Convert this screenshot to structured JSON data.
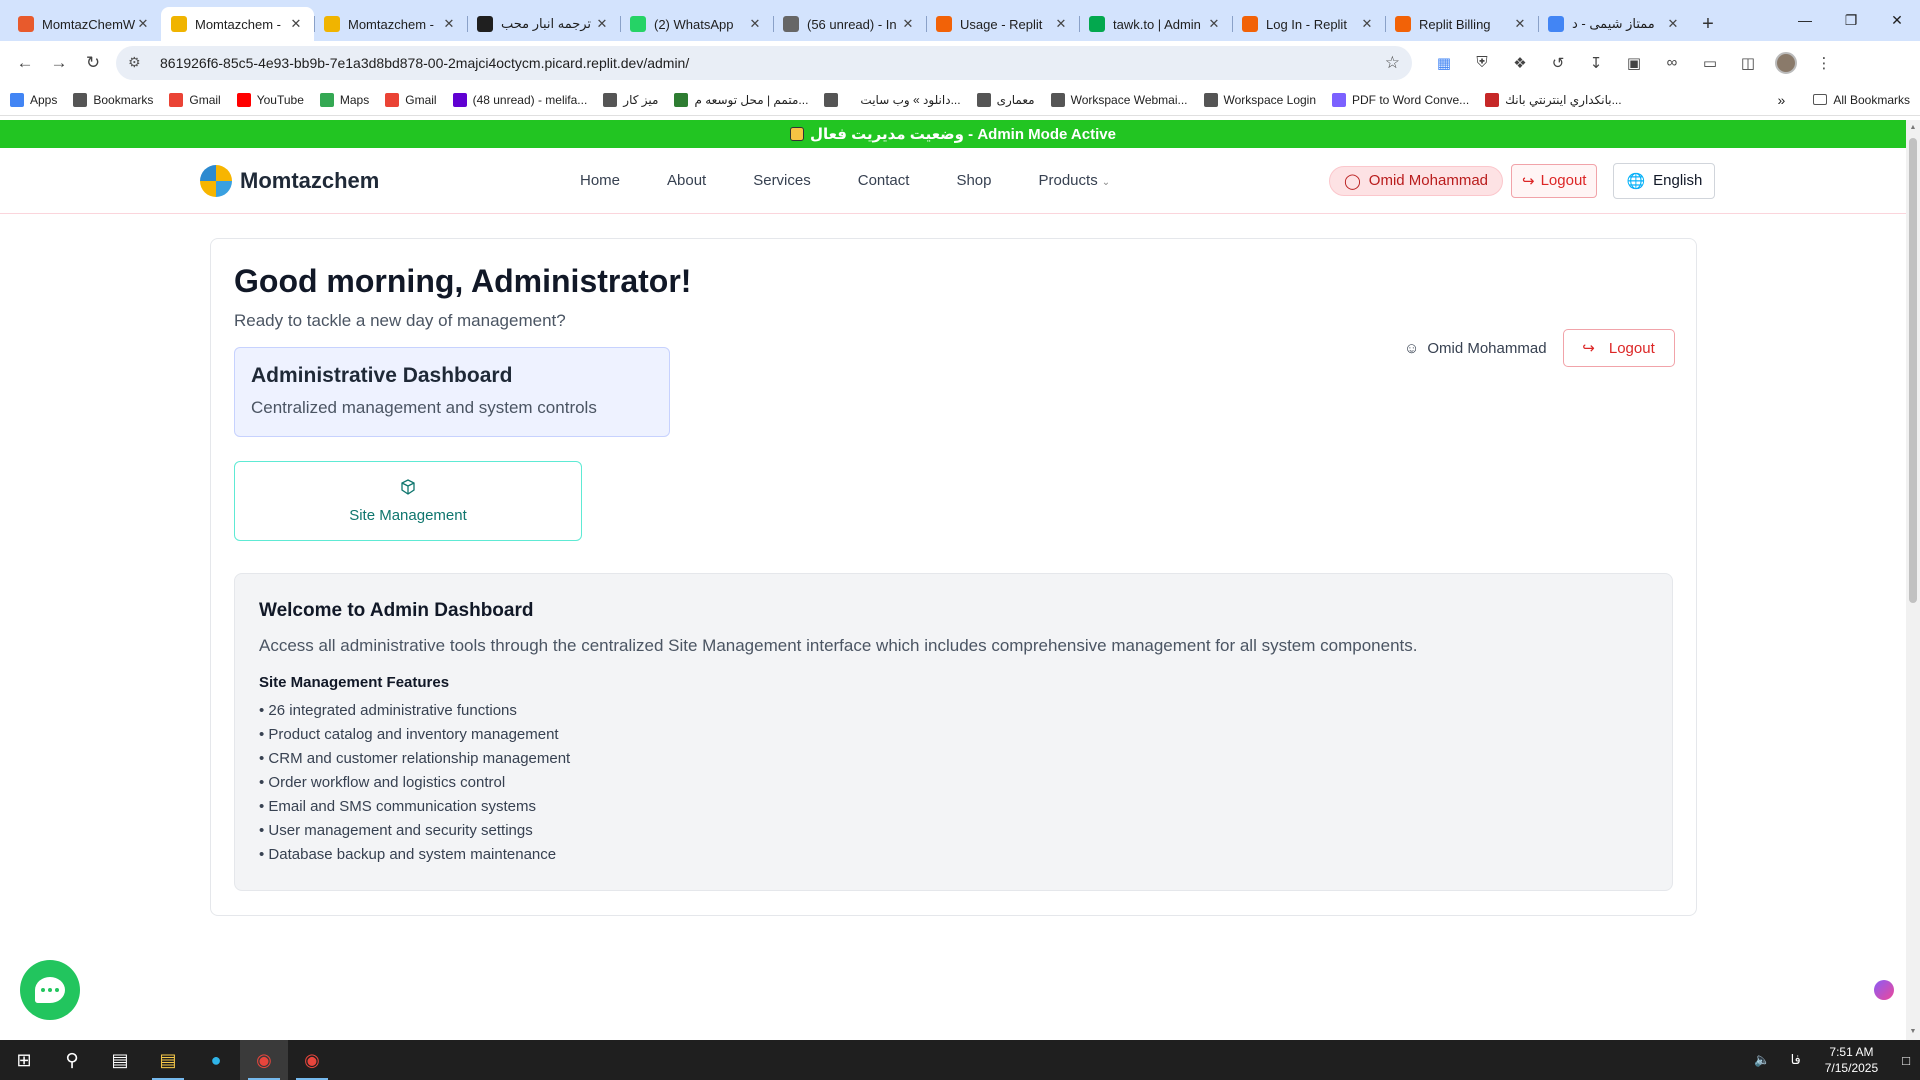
{
  "browser": {
    "tabs": [
      {
        "title": "MomtazChemW",
        "favicon_color": "#e85a2c",
        "active": false
      },
      {
        "title": "Momtazchem -",
        "favicon_color": "#f0b400",
        "active": true
      },
      {
        "title": "Momtazchem -",
        "favicon_color": "#f0b400",
        "active": false
      },
      {
        "title": "ترجمه انبار محب",
        "favicon_color": "#1f1f1f",
        "active": false
      },
      {
        "title": "(2) WhatsApp",
        "favicon_color": "#25d366",
        "active": false
      },
      {
        "title": "(56 unread) - In",
        "favicon_color": "#666666",
        "active": false
      },
      {
        "title": "Usage - Replit",
        "favicon_color": "#f26207",
        "active": false
      },
      {
        "title": "tawk.to | Admin",
        "favicon_color": "#03a84e",
        "active": false
      },
      {
        "title": "Log In - Replit",
        "favicon_color": "#f26207",
        "active": false
      },
      {
        "title": "Replit Billing",
        "favicon_color": "#f26207",
        "active": false
      },
      {
        "title": "ممتاز شیمی - د",
        "favicon_color": "#4285f4",
        "active": false
      }
    ],
    "new_tab_label": "+",
    "url": "861926f6-85c5-4e93-bb9b-7e1a3d8bd878-00-2majci4octycm.picard.replit.dev/admin/",
    "bookmarks": [
      {
        "label": "Apps",
        "icon": "apps-grid-icon",
        "color": "#4285f4"
      },
      {
        "label": "Bookmarks",
        "icon": "star-icon",
        "color": "#555555"
      },
      {
        "label": "Gmail",
        "icon": "gmail-icon",
        "color": "#ea4335"
      },
      {
        "label": "YouTube",
        "icon": "youtube-icon",
        "color": "#ff0000"
      },
      {
        "label": "Maps",
        "icon": "maps-icon",
        "color": "#34a853"
      },
      {
        "label": "Gmail",
        "icon": "gmail-icon",
        "color": "#ea4335"
      },
      {
        "label": "(48 unread) - melifa...",
        "icon": "yahoo-mail-icon",
        "color": "#6001d2"
      },
      {
        "label": "میز کار",
        "icon": "globe-icon",
        "color": "#555555"
      },
      {
        "label": "متمم | محل توسعه م...",
        "icon": "leaf-icon",
        "color": "#2e7d32"
      },
      {
        "label": "",
        "icon": "globe-icon",
        "color": "#555555"
      },
      {
        "label": "دانلود » وب سایت...",
        "icon": "",
        "color": "#555555"
      },
      {
        "label": "معماری",
        "icon": "folder-icon",
        "color": "#555555"
      },
      {
        "label": "Workspace Webmai...",
        "icon": "globe-icon",
        "color": "#555555"
      },
      {
        "label": "Workspace Login",
        "icon": "globe-icon",
        "color": "#555555"
      },
      {
        "label": "PDF to Word Conve...",
        "icon": "pdf-icon",
        "color": "#7b61ff"
      },
      {
        "label": "بانكداري اينترنتي بانك...",
        "icon": "bank-icon",
        "color": "#c62828"
      }
    ],
    "all_bookmarks_label": "All Bookmarks"
  },
  "site": {
    "admin_banner": "وضعیت مدیریت فعال - Admin Mode Active",
    "brand_name": "Momtazchem",
    "nav": [
      "Home",
      "About",
      "Services",
      "Contact",
      "Shop",
      "Products"
    ],
    "user_pill": "Omid Mohammad",
    "logout_label": "Logout",
    "language_label": "English"
  },
  "dashboard": {
    "greeting": "Good morning, Administrator!",
    "subtitle": "Ready to tackle a new day of management?",
    "panel_title": "Administrative Dashboard",
    "panel_subtitle": "Centralized management and system controls",
    "user_name": "Omid Mohammad",
    "logout_label": "Logout",
    "site_management_label": "Site Management",
    "welcome_title": "Welcome to Admin Dashboard",
    "welcome_desc": "Access all administrative tools through the centralized Site Management interface which includes comprehensive management for all system components.",
    "features_title": "Site Management Features",
    "features": [
      "• 26 integrated administrative functions",
      "• Product catalog and inventory management",
      "• CRM and customer relationship management",
      "• Order workflow and logistics control",
      "• Email and SMS communication systems",
      "• User management and security settings",
      "• Database backup and system maintenance"
    ]
  },
  "taskbar": {
    "language_indicator": "فا",
    "time": "7:51 AM",
    "date": "7/15/2025"
  },
  "colors": {
    "banner_green": "#22c522",
    "accent_teal": "#0f766e",
    "logout_red": "#dc2626"
  }
}
